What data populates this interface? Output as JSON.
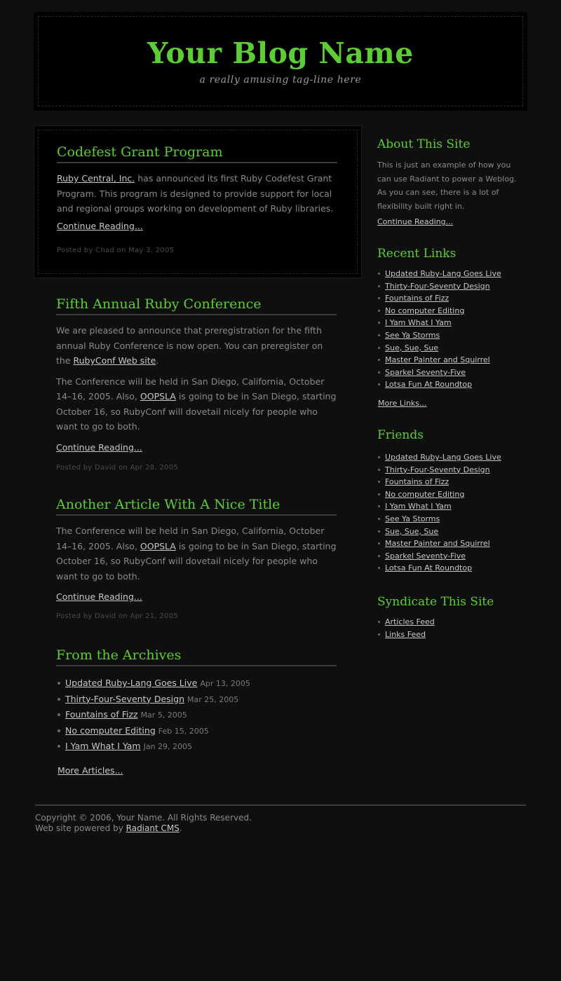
{
  "header": {
    "title": "Your Blog Name",
    "tagline": "a really amusing tag-line here"
  },
  "articles": [
    {
      "title": "Codefest Grant Program",
      "link_text": "Ruby Central, Inc.",
      "body_rest": " has announced its first Ruby Codefest Grant Program. This program is designed to provide support for local and regional groups working on development of Ruby libraries.",
      "continue": "Continue Reading...",
      "posted_prefix": "Posted by ",
      "author": "Chad",
      "posted_mid": " on ",
      "date": "May 3, 2005"
    },
    {
      "title": "Fifth Annual Ruby Conference",
      "p1_text": "We are pleased to announce that preregistration for the fifth annual Ruby Conference is now open.  You can preregister on the ",
      "p1_link": "RubyConf Web site",
      "p1_end": ".",
      "p2_start": "The Conference will be held in San Diego, California, October 14–16, 2005.  Also, ",
      "p2_link": "OOPSLA",
      "p2_end": " is going to be in San Diego, starting October 16, so RubyConf will dovetail nicely for people who want to go to both.",
      "continue": "Continue Reading...",
      "posted_prefix": "Posted by ",
      "author": "David",
      "posted_mid": " on ",
      "date": "Apr 28, 2005"
    },
    {
      "title": "Another Article With A Nice Title",
      "p_start": "The Conference will be held in San Diego, California, October 14–16, 2005.  Also, ",
      "p_link": "OOPSLA",
      "p_end": " is going to be in San Diego, starting October 16, so RubyConf will dovetail nicely for people who want to go to both.",
      "continue": "Continue Reading...",
      "posted_prefix": "Posted by ",
      "author": "David",
      "posted_mid": " on ",
      "date": "Apr 21, 2005"
    }
  ],
  "archives": {
    "title": "From the Archives",
    "items": [
      {
        "label": "Updated Ruby-Lang Goes Live",
        "date": "Apr 13, 2005"
      },
      {
        "label": "Thirty-Four-Seventy Design",
        "date": "Mar 25, 2005"
      },
      {
        "label": "Fountains of Fizz",
        "date": "Mar 5, 2005"
      },
      {
        "label": "No computer Editing",
        "date": "Feb 15, 2005"
      },
      {
        "label": "I Yam What I Yam",
        "date": "Jan 29, 2005"
      }
    ],
    "more": "More Articles..."
  },
  "sidebar": {
    "about": {
      "title": "About This Site",
      "text": "This is just an example of how you can use Radiant to power a Weblog. As you can see, there is a lot of flexibility built right in.",
      "more": "Continue Reading..."
    },
    "recent_links": {
      "title": "Recent Links",
      "items": [
        "Updated Ruby-Lang Goes Live",
        "Thirty-Four-Seventy Design",
        "Fountains of Fizz",
        "No computer Editing",
        "I Yam What I Yam",
        "See Ya Storms",
        "Sue, Sue, Sue",
        "Master Painter and Squirrel",
        "Sparkel Seventy-Five",
        "Lotsa Fun At Roundtop"
      ],
      "more": "More Links..."
    },
    "friends": {
      "title": "Friends",
      "items": [
        "Updated Ruby-Lang Goes Live",
        "Thirty-Four-Seventy Design",
        "Fountains of Fizz",
        "No computer Editing",
        "I Yam What I Yam",
        "See Ya Storms",
        "Sue, Sue, Sue",
        "Master Painter and Squirrel",
        "Sparkel Seventy-Five",
        "Lotsa Fun At Roundtop"
      ]
    },
    "syndicate": {
      "title": "Syndicate This Site",
      "items": [
        "Articles Feed",
        "Links Feed"
      ]
    }
  },
  "footer": {
    "copyright": "Copyright © 2006, Your Name. All Rights Reserved.",
    "powered_prefix": "Web site powered by ",
    "powered_link": "Radiant CMS",
    "powered_end": "."
  }
}
